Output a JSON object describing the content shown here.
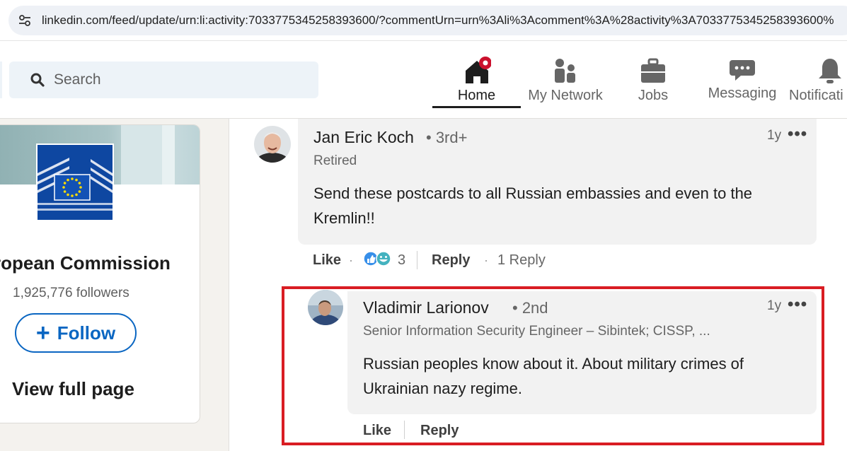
{
  "browser": {
    "url": "linkedin.com/feed/update/urn:li:activity:7033775345258393600/?commentUrn=urn%3Ali%3Acomment%3A%28activity%3A7033775345258393600%"
  },
  "nav": {
    "search_placeholder": "Search",
    "items": [
      {
        "label": "Home",
        "icon": "home-icon",
        "active": true
      },
      {
        "label": "My Network",
        "icon": "people-icon",
        "active": false
      },
      {
        "label": "Jobs",
        "icon": "briefcase-icon",
        "active": false
      },
      {
        "label": "Messaging",
        "icon": "chat-bubble-icon",
        "active": false
      },
      {
        "label": "Notificati",
        "icon": "bell-icon",
        "active": false
      }
    ]
  },
  "company_card": {
    "name": "ropean Commission",
    "followers": "1,925,776 followers",
    "follow_label": "Follow",
    "follow_plus": "+",
    "view_full_page": "View full page"
  },
  "comments": [
    {
      "author": "Jan Eric Koch",
      "degree": "• 3rd+",
      "headline": "Retired",
      "text_line1": "Send these postcards to all Russian embassies and even to the",
      "text_line2": "Kremlin!!",
      "time": "1y",
      "more": "•••",
      "like_label": "Like",
      "reaction_count": "3",
      "reply_label": "Reply",
      "replies_label": "1 Reply"
    },
    {
      "author": "Vladimir Larionov",
      "degree": "• 2nd",
      "headline": "Senior Information Security Engineer – Sibintek; CISSP, ...",
      "text_line1": "Russian peoples know about it. About military crimes of",
      "text_line2": "Ukrainian nazy regime.",
      "time": "1y",
      "more": "•••",
      "like_label": "Like",
      "reply_label": "Reply"
    }
  ],
  "colors": {
    "linkedin_blue": "#0a66c2",
    "notification_red": "#cb112d",
    "highlight_red": "#d91d23",
    "eu_blue": "#0e47a1",
    "eu_star_yellow": "#ffdd00"
  },
  "separator_dot": "·"
}
